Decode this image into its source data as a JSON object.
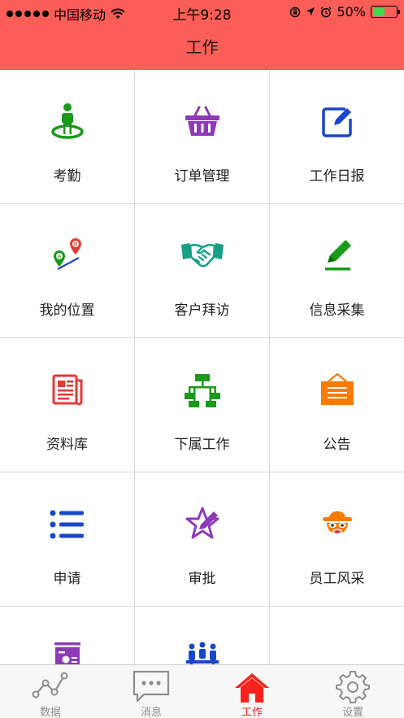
{
  "status_bar": {
    "carrier": "中国移动",
    "time": "上午9:28",
    "battery": "50%",
    "battery_level": 0.5,
    "icons": [
      "signal-dots",
      "wifi-icon",
      "orientation-lock-icon",
      "location-arrow-icon",
      "alarm-icon",
      "battery-icon"
    ]
  },
  "nav": {
    "title": "工作"
  },
  "colors": {
    "header_bg": "#fb5e57",
    "green": "#1a9a1a",
    "purple": "#8e3ab8",
    "blue": "#1a46c8",
    "orange": "#f57c00",
    "red": "#e53935",
    "teal": "#17a085",
    "tab_active": "#f5231b",
    "tab_inactive": "#8e8e8e"
  },
  "grid": {
    "items": [
      {
        "label": "考勤",
        "icon": "attendance-person-icon"
      },
      {
        "label": "订单管理",
        "icon": "basket-icon"
      },
      {
        "label": "工作日报",
        "icon": "edit-square-icon"
      },
      {
        "label": "我的位置",
        "icon": "location-ab-icon"
      },
      {
        "label": "客户拜访",
        "icon": "handshake-icon"
      },
      {
        "label": "信息采集",
        "icon": "pencil-icon"
      },
      {
        "label": "资料库",
        "icon": "newspaper-icon"
      },
      {
        "label": "下属工作",
        "icon": "org-chart-icon"
      },
      {
        "label": "公告",
        "icon": "notice-board-icon"
      },
      {
        "label": "申请",
        "icon": "list-icon"
      },
      {
        "label": "审批",
        "icon": "star-pen-icon"
      },
      {
        "label": "员工风采",
        "icon": "hat-face-icon"
      },
      {
        "label": "",
        "icon": "presentation-chart-icon"
      },
      {
        "label": "",
        "icon": "meeting-icon"
      }
    ]
  },
  "tabbar": {
    "tabs": [
      {
        "label": "数据",
        "icon": "line-chart-icon",
        "active": false
      },
      {
        "label": "消息",
        "icon": "chat-bubble-icon",
        "active": false
      },
      {
        "label": "工作",
        "icon": "home-icon",
        "active": true
      },
      {
        "label": "设置",
        "icon": "gear-icon",
        "active": false
      }
    ]
  }
}
